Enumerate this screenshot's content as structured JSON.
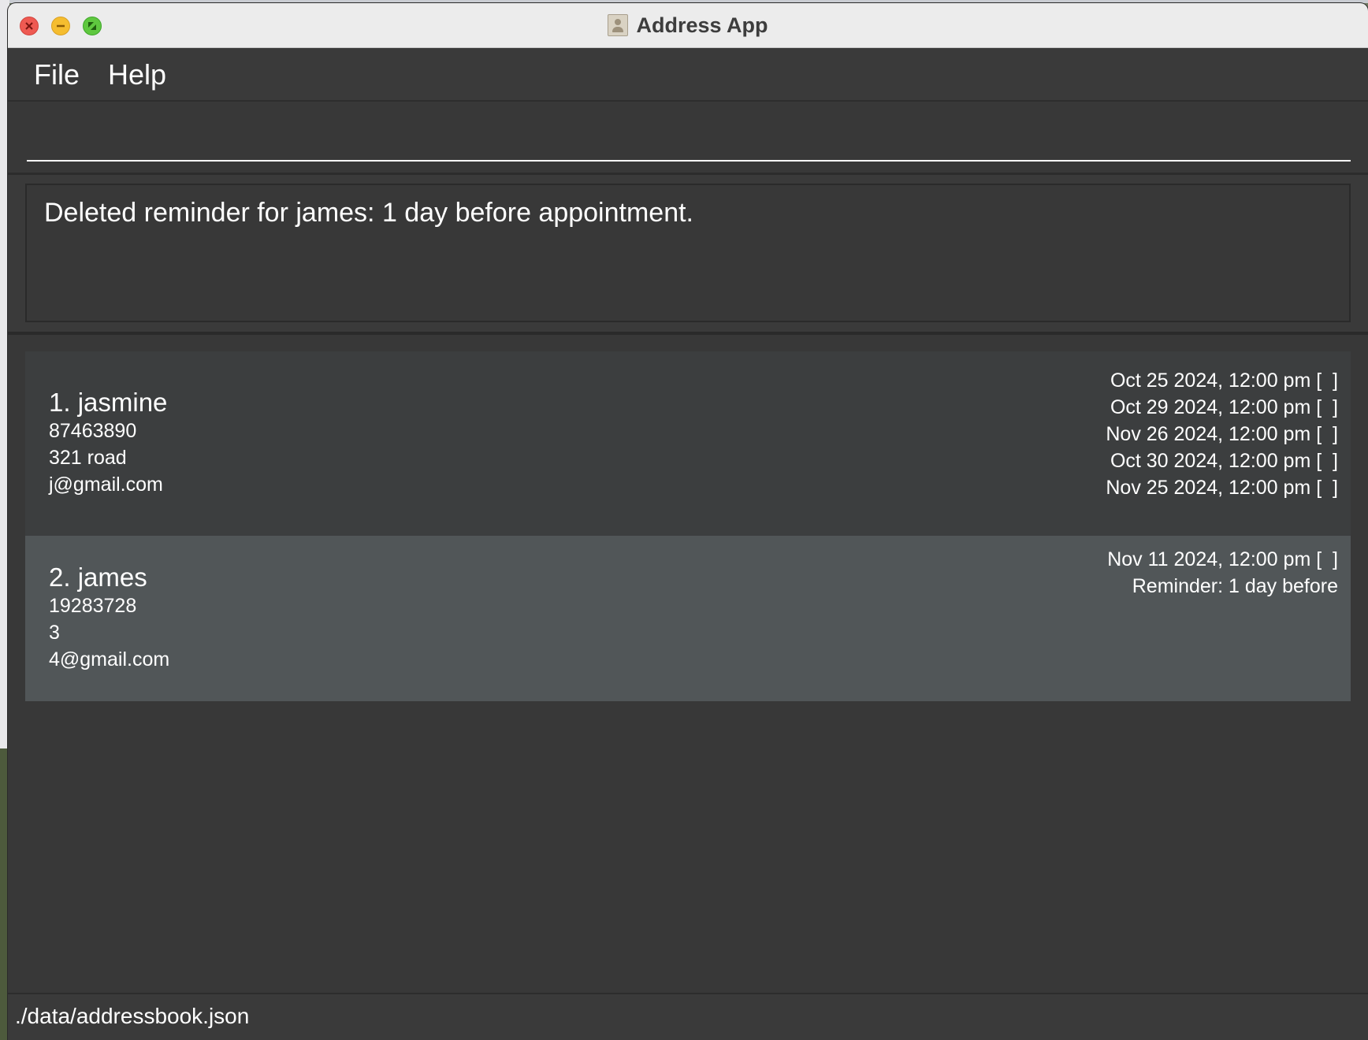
{
  "window": {
    "title": "Address App"
  },
  "menu": {
    "items": [
      {
        "label": "File"
      },
      {
        "label": "Help"
      }
    ]
  },
  "command": {
    "value": "",
    "placeholder": ""
  },
  "result": {
    "message": "Deleted reminder for james: 1 day before appointment."
  },
  "persons": [
    {
      "name": "1. jasmine",
      "phone": "87463890",
      "address": "321 road",
      "email": "j@gmail.com",
      "appointments": [
        "Oct 25 2024, 12:00 pm [  ]",
        "Oct 29 2024, 12:00 pm [  ]",
        "Nov 26 2024, 12:00 pm [  ]",
        "Oct 30 2024, 12:00 pm [  ]",
        "Nov 25 2024, 12:00 pm [  ]"
      ]
    },
    {
      "name": "2. james",
      "phone": "19283728",
      "address": "3",
      "email": "4@gmail.com",
      "appointments": [
        "Nov 11 2024, 12:00 pm [  ]",
        "Reminder: 1 day before"
      ]
    }
  ],
  "status": {
    "file_path": "./data/addressbook.json"
  },
  "icons": {
    "close": "close-icon",
    "minimize": "minimize-icon",
    "fullscreen": "fullscreen-icon",
    "app": "address-book-icon"
  },
  "colors": {
    "background": "#383838",
    "card_default": "#3c3e3f",
    "card_selected": "#515658",
    "text": "#ffffff"
  }
}
